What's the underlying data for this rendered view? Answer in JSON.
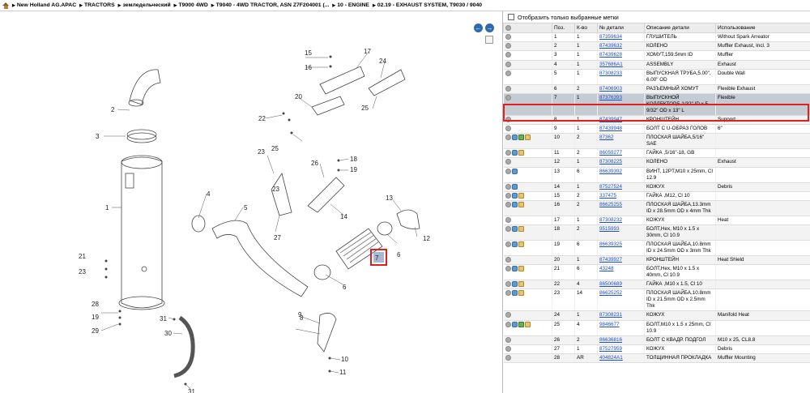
{
  "breadcrumb": [
    "New Holland AG.APAC",
    "TRACTORS",
    "земледельческий",
    "T9000 4WD",
    "T9040 - 4WD TRACTOR, ASN Z7F204001 (...",
    "10 - ENGINE",
    "02.19 - EXHAUST SYSTEM, T9030 / 9040"
  ],
  "nav": {
    "back": "←",
    "forward": "→"
  },
  "filter_label": "Отобразить только выбранные метки",
  "columns": [
    "Поз.",
    "К-во",
    "№ детали",
    "Описание детали",
    "Использование"
  ],
  "rows": [
    {
      "pos": "1",
      "qty": "1",
      "part": "87359634",
      "desc": "ГЛУШИТЕЛЬ",
      "use": "Without Spark Arreator",
      "icons": []
    },
    {
      "pos": "2",
      "qty": "1",
      "part": "87439632",
      "desc": "КОЛЕНО",
      "use": "Muffler Exhaust, Incl. 3",
      "icons": []
    },
    {
      "pos": "3",
      "qty": "1",
      "part": "87439628",
      "desc": "ХОМУТ,159.5mm ID",
      "use": "Muffler",
      "icons": []
    },
    {
      "pos": "4",
      "qty": "1",
      "part": "357686A1",
      "desc": "ASSEMBLY",
      "use": "Exhaust",
      "icons": []
    },
    {
      "pos": "5",
      "qty": "1",
      "part": "87308233",
      "desc": "ВЫПУСКНАЯ ТРУБА,5.00\", 6.00\" OD",
      "use": "Double Wall",
      "icons": []
    },
    {
      "pos": "6",
      "qty": "2",
      "part": "87406903",
      "desc": "РАЗЪЕМНЫЙ ХОМУТ",
      "use": "Flexible Exhaust",
      "icons": []
    },
    {
      "pos": "7",
      "qty": "1",
      "part": "87376393",
      "desc": "ВЫПУСКНОЙ КОЛЛЕКТОР,5-1/32\" ID x 5-9/32\" OD x 13\" L",
      "use": "Flexible",
      "icons": [],
      "selected": true
    },
    {
      "pos": "8",
      "qty": "1",
      "part": "87439947",
      "desc": "КРОНШТЕЙН",
      "use": "Support",
      "icons": []
    },
    {
      "pos": "9",
      "qty": "1",
      "part": "87439948",
      "desc": "БОЛТ С U-ОБРАЗ ГОЛОВ",
      "use": "6\"",
      "icons": []
    },
    {
      "pos": "10",
      "qty": "2",
      "part": "87362",
      "desc": "ПЛОСКАЯ ШАЙБА,5/16\" SAE",
      "use": "",
      "icons": [
        "blue",
        "green",
        "box"
      ]
    },
    {
      "pos": "11",
      "qty": "2",
      "part": "86059277",
      "desc": "ГАЙКА ,5/16\"-18, GB",
      "use": "",
      "icons": [
        "blue",
        "box"
      ]
    },
    {
      "pos": "12",
      "qty": "1",
      "part": "87308225",
      "desc": "КОЛЕНО",
      "use": "Exhaust",
      "icons": []
    },
    {
      "pos": "13",
      "qty": "6",
      "part": "86639392",
      "desc": "ВИНТ, 12PT,M10 x 25mm, Cl 12.9",
      "use": "",
      "icons": [
        "blue"
      ]
    },
    {
      "pos": "14",
      "qty": "1",
      "part": "87527524",
      "desc": "КОЖУХ",
      "use": "Debris",
      "icons": [
        "blue"
      ]
    },
    {
      "pos": "15",
      "qty": "2",
      "part": "337475",
      "desc": "ГАЙКА ,M12, Cl 10",
      "use": "",
      "icons": [
        "blue",
        "box"
      ]
    },
    {
      "pos": "16",
      "qty": "2",
      "part": "86625255",
      "desc": "ПЛОСКАЯ ШАЙБА,13.3mm ID x 28.5mm OD x 4mm Thk",
      "use": "",
      "icons": [
        "blue",
        "box"
      ]
    },
    {
      "pos": "17",
      "qty": "1",
      "part": "87308232",
      "desc": "КОЖУХ",
      "use": "Heat",
      "icons": []
    },
    {
      "pos": "18",
      "qty": "2",
      "part": "9515993",
      "desc": "БОЛТ,Hex, M10 x 1.5 x 30mm, Cl 10.9",
      "use": "",
      "icons": [
        "blue",
        "box"
      ]
    },
    {
      "pos": "19",
      "qty": "6",
      "part": "86639325",
      "desc": "ПЛОСКАЯ ШАЙБА,10.8mm ID x 24.5mm OD x 3mm Thk",
      "use": "",
      "icons": [
        "blue",
        "box"
      ]
    },
    {
      "pos": "20",
      "qty": "1",
      "part": "87439927",
      "desc": "КРОНШТЕЙН",
      "use": "Heat Shield",
      "icons": []
    },
    {
      "pos": "21",
      "qty": "6",
      "part": "43248",
      "desc": "БОЛТ,Hex, M10 x 1.5 x 40mm, Cl 10.9",
      "use": "",
      "icons": [
        "blue",
        "box"
      ]
    },
    {
      "pos": "22",
      "qty": "4",
      "part": "86500689",
      "desc": "ГАЙКА ,M10 x 1.5, Cl 10",
      "use": "",
      "icons": [
        "blue",
        "box"
      ]
    },
    {
      "pos": "23",
      "qty": "14",
      "part": "86625252",
      "desc": "ПЛОСКАЯ ШАЙБА,10.8mm ID x 21.5mm OD x 2.5mm Thk",
      "use": "",
      "icons": [
        "blue",
        "box"
      ]
    },
    {
      "pos": "24",
      "qty": "1",
      "part": "87308231",
      "desc": "КОЖУХ",
      "use": "Manifold Heat",
      "icons": []
    },
    {
      "pos": "25",
      "qty": "4",
      "part": "9846677",
      "desc": "БОЛТ,M10 x 1.5 x 25mm, Cl 10.9",
      "use": "",
      "icons": [
        "blue",
        "green",
        "box"
      ]
    },
    {
      "pos": "26",
      "qty": "2",
      "part": "86636816",
      "desc": "БОЛТ С КВАДР. ПОДГОЛ",
      "use": "M10 x 25, CL8.8",
      "icons": []
    },
    {
      "pos": "27",
      "qty": "1",
      "part": "87527959",
      "desc": "КОЖУХ",
      "use": "Debris",
      "icons": []
    },
    {
      "pos": "28",
      "qty": "AR",
      "part": "404824A1",
      "desc": "ТОЛЩИННАЯ ПРОКЛАДКА",
      "use": "Muffler Mounting",
      "icons": []
    }
  ],
  "callouts": [
    "1",
    "2",
    "3",
    "4",
    "5",
    "6",
    "6",
    "7",
    "8",
    "9",
    "10",
    "11",
    "12",
    "13",
    "14",
    "15",
    "16",
    "17",
    "18",
    "19",
    "20",
    "21",
    "22",
    "23",
    "23",
    "23",
    "24",
    "25",
    "25",
    "26",
    "27",
    "28",
    "19",
    "29",
    "30",
    "31",
    "31"
  ],
  "highlight_label": "7"
}
